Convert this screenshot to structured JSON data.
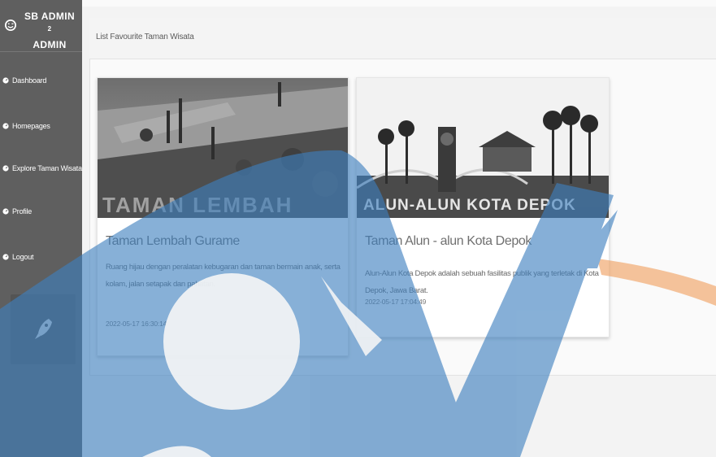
{
  "sidebar": {
    "brand_line1": "SB ADMIN",
    "brand_sup": "2",
    "brand_line2": "ADMIN",
    "items": [
      {
        "label": "Dashboard",
        "icon": "dashboard-icon"
      },
      {
        "label": "Homepages",
        "icon": "home-icon"
      },
      {
        "label": "Explore Taman Wisata",
        "icon": "explore-icon"
      },
      {
        "label": "Profile",
        "icon": "profile-icon"
      },
      {
        "label": "Logout",
        "icon": "logout-icon"
      }
    ],
    "toggle_icon": "rocket-icon"
  },
  "main": {
    "panel_title": "List Favourite Taman Wisata",
    "cards": [
      {
        "image_sign_text": "TAMAN LEMBAH",
        "title": "Taman Lembah Gurame",
        "description": "Ruang hijau dengan peralatan kebugaran dan taman bermain anak, serta kolam, jalan setapak dan pahatan.",
        "date": "2022-05-17 16:30:14"
      },
      {
        "image_sign_text": "ALUN-ALUN KOTA DEPOK",
        "title": "Taman Alun - alun Kota Depok",
        "description": "Alun-Alun Kota Depok adalah sebuah fasilitas publik yang terletak di Kota Depok, Jawa Barat.",
        "date": "2022-05-17 17:04:49"
      }
    ]
  },
  "colors": {
    "sidebar": "#5f5f5f",
    "watermark_blue": "#3d7fbf",
    "watermark_orange": "#f0a060"
  }
}
